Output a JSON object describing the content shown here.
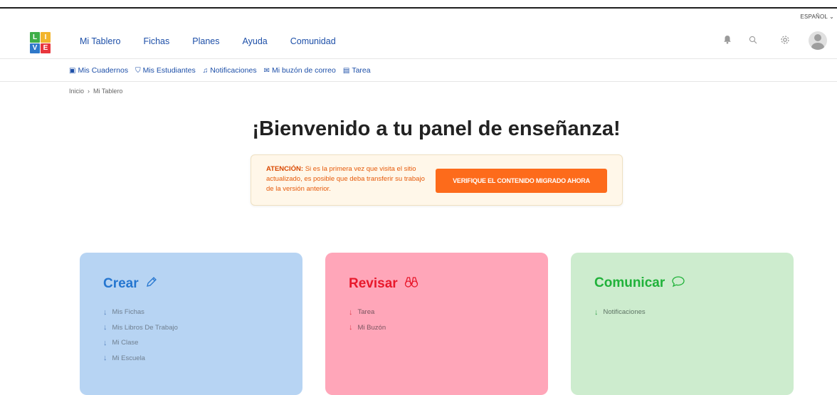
{
  "language": {
    "label": "ESPAÑOL",
    "chevron": "⌄"
  },
  "logo": {
    "letters": [
      "L",
      "I",
      "V",
      "E"
    ],
    "colors": [
      "#3fae49",
      "#f2b52e",
      "#2e78c9",
      "#e8363d"
    ]
  },
  "nav": {
    "items": [
      "Mi Tablero",
      "Fichas",
      "Planes",
      "Ayuda",
      "Comunidad"
    ]
  },
  "top_icons": [
    "bell-icon",
    "search-icon",
    "gear-icon",
    "avatar"
  ],
  "subnav": {
    "items": [
      {
        "label": "Mis Cuadernos",
        "icon": "notebook-icon"
      },
      {
        "label": "Mis Estudiantes",
        "icon": "students-icon"
      },
      {
        "label": "Notificaciones",
        "icon": "bell-icon"
      },
      {
        "label": "Mi buzón de correo",
        "icon": "mail-icon"
      },
      {
        "label": "Tarea",
        "icon": "task-icon"
      }
    ]
  },
  "breadcrumb": {
    "home": "Inicio",
    "separator": "›",
    "current": "Mi Tablero"
  },
  "page": {
    "title": "¡Bienvenido a tu panel de enseñanza!"
  },
  "alert": {
    "label": "ATENCIÓN:",
    "message": "Si es la primera vez que visita el sitio actualizado, es posible que deba transferir su trabajo de la versión anterior.",
    "button": "VERIFIQUE EL CONTENIDO MIGRADO AHORA"
  },
  "cards": [
    {
      "title": "Crear",
      "icon": "pencil-icon",
      "color": "#2576d0",
      "items": [
        "Mis Fichas",
        "Mis Libros De Trabajo",
        "Mi Clase",
        "Mi Escuela"
      ]
    },
    {
      "title": "Revisar",
      "icon": "binoculars-icon",
      "color": "#e8192c",
      "items": [
        "Tarea",
        "Mi Buzón"
      ]
    },
    {
      "title": "Comunicar",
      "icon": "speech-bubble-icon",
      "color": "#20b23a",
      "items": [
        "Notificaciones"
      ]
    }
  ]
}
